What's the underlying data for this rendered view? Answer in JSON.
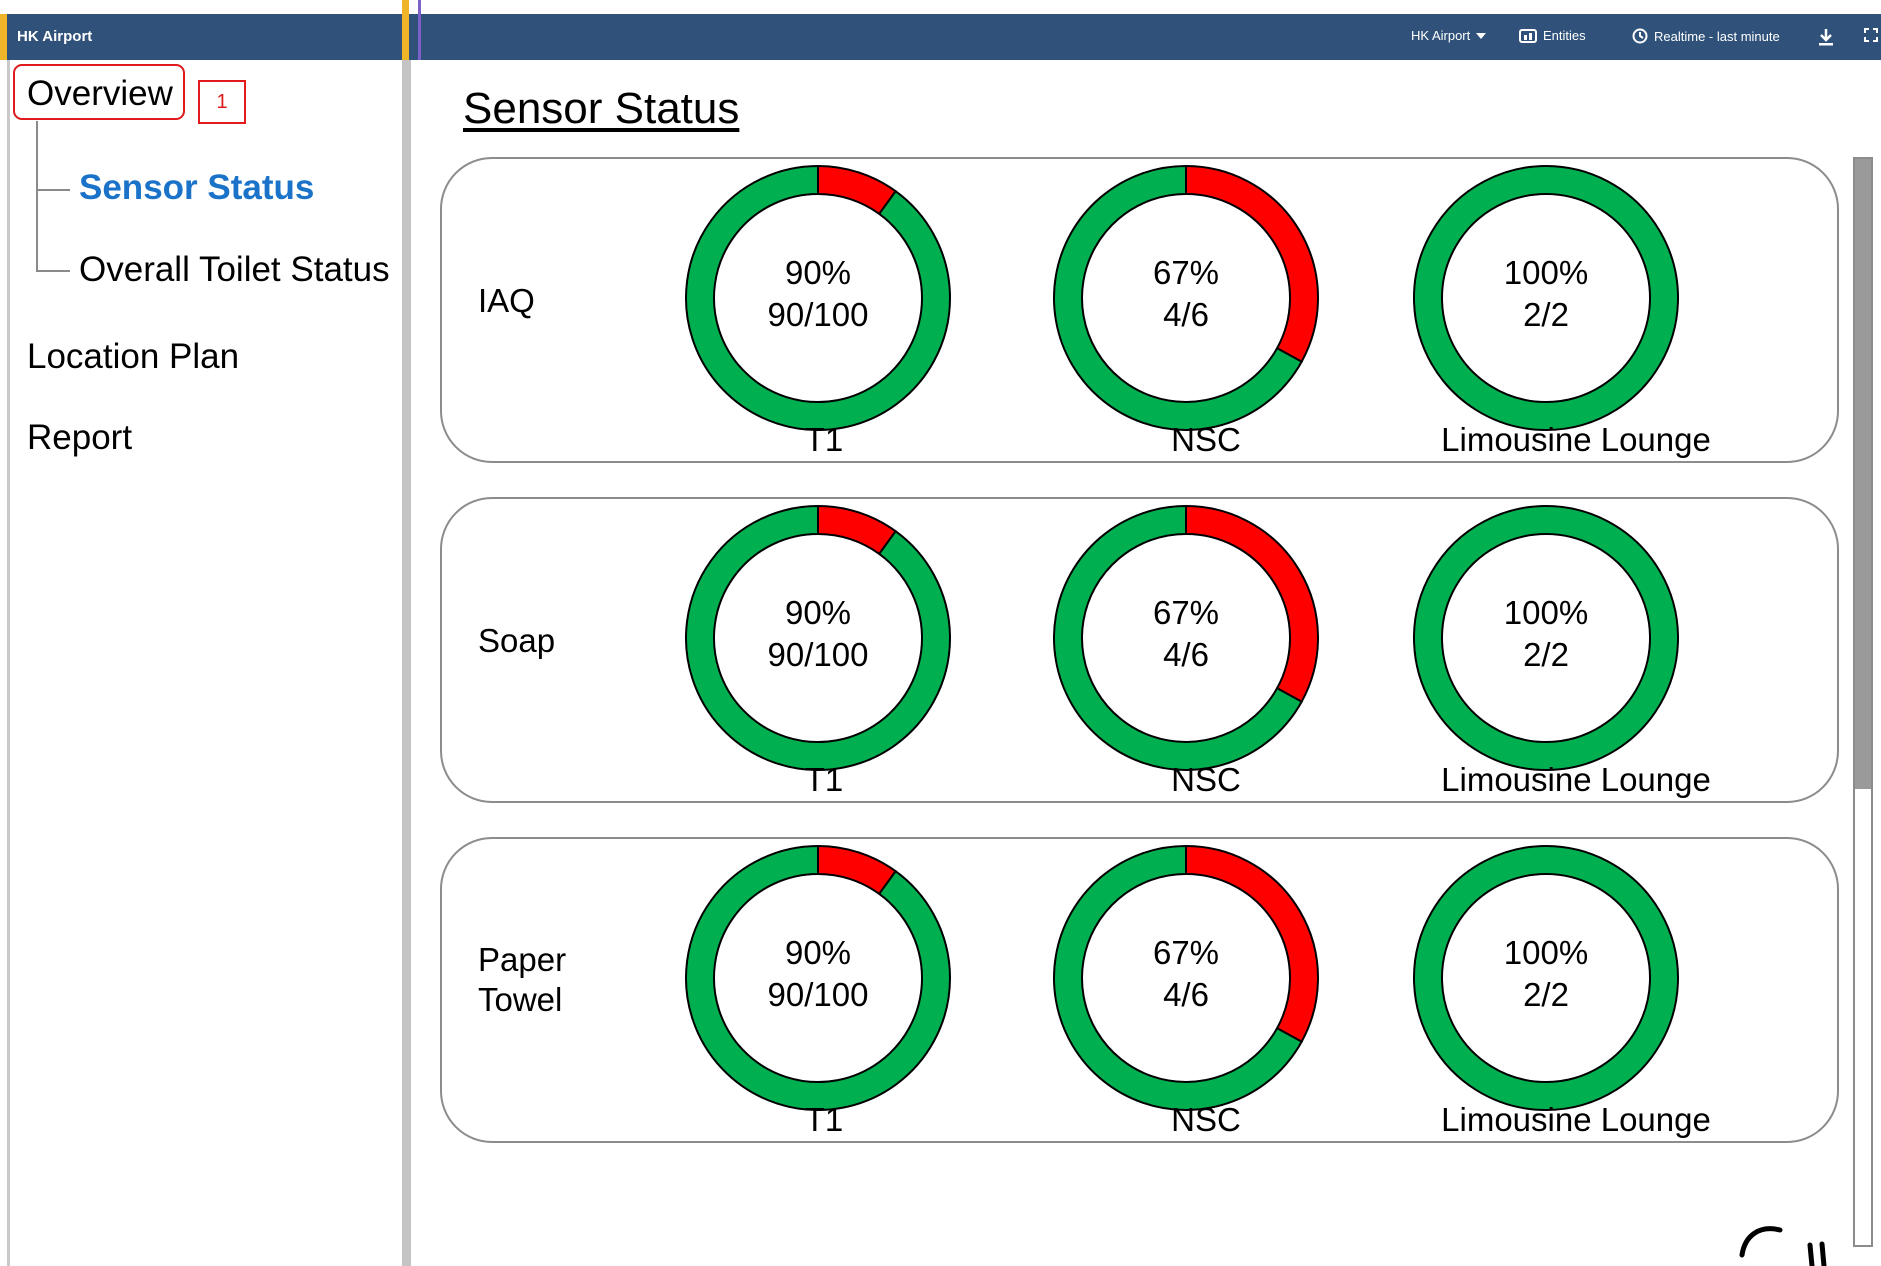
{
  "topbar": {
    "app_title": "HK Airport",
    "site_selector": "HK Airport",
    "entities_label": "Entities",
    "time_label": "Realtime - last minute"
  },
  "sidebar": {
    "overview": "Overview",
    "badge": "1",
    "sub_items": [
      "Sensor Status",
      "Overall Toilet Status"
    ],
    "location_plan": "Location Plan",
    "report": "Report",
    "active_color": "#1a73c8"
  },
  "main": {
    "title": "Sensor Status",
    "colors": {
      "ok": "#00b050",
      "fault": "#ff0000"
    },
    "rows": [
      {
        "label_lines": [
          "IAQ"
        ],
        "gauges": [
          {
            "location": "T1",
            "percent": "90%",
            "fraction": "90/100",
            "ok_ratio": 0.9
          },
          {
            "location": "NSC",
            "percent": "67%",
            "fraction": "4/6",
            "ok_ratio": 0.67
          },
          {
            "location": "Limousine Lounge",
            "percent": "100%",
            "fraction": "2/2",
            "ok_ratio": 1.0
          }
        ]
      },
      {
        "label_lines": [
          "Soap"
        ],
        "gauges": [
          {
            "location": "T1",
            "percent": "90%",
            "fraction": "90/100",
            "ok_ratio": 0.9
          },
          {
            "location": "NSC",
            "percent": "67%",
            "fraction": "4/6",
            "ok_ratio": 0.67
          },
          {
            "location": "Limousine Lounge",
            "percent": "100%",
            "fraction": "2/2",
            "ok_ratio": 1.0
          }
        ]
      },
      {
        "label_lines": [
          "Paper",
          "Towel"
        ],
        "gauges": [
          {
            "location": "T1",
            "percent": "90%",
            "fraction": "90/100",
            "ok_ratio": 0.9
          },
          {
            "location": "NSC",
            "percent": "67%",
            "fraction": "4/6",
            "ok_ratio": 0.67
          },
          {
            "location": "Limousine Lounge",
            "percent": "100%",
            "fraction": "2/2",
            "ok_ratio": 1.0
          }
        ]
      }
    ]
  }
}
